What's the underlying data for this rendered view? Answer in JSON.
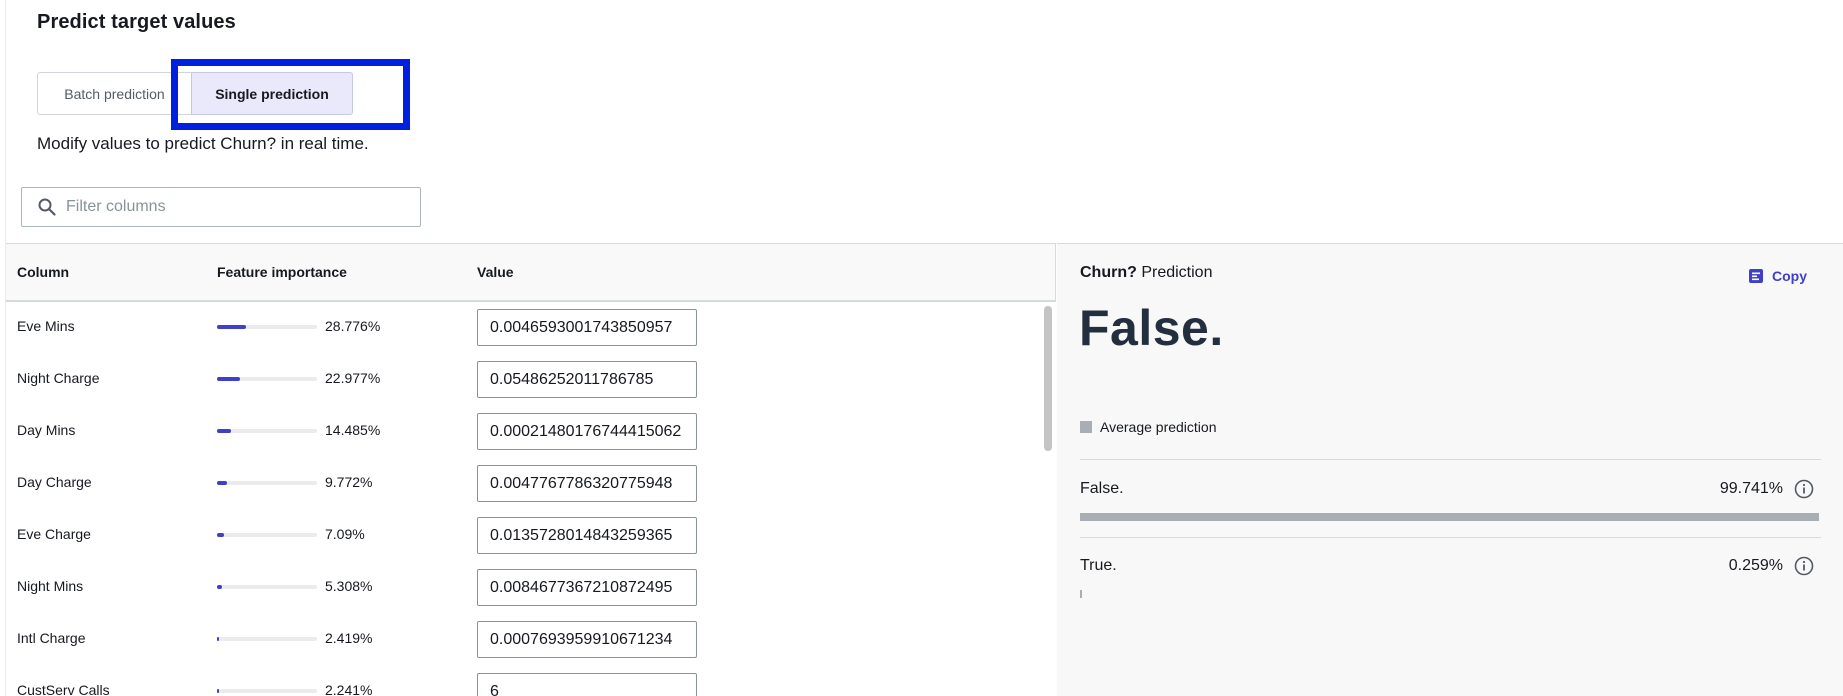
{
  "page": {
    "title": "Predict target values",
    "subtitle": "Modify values to predict Churn? in real time."
  },
  "mode": {
    "options": [
      "Batch prediction",
      "Single prediction"
    ],
    "selected": "Single prediction"
  },
  "filter": {
    "placeholder": "Filter columns"
  },
  "table": {
    "headers": {
      "column": "Column",
      "importance": "Feature importance",
      "value": "Value"
    },
    "rows": [
      {
        "name": "Eve Mins",
        "importance_pct": "28.776%",
        "importance": 0.28776,
        "value": "0.0046593001743850957"
      },
      {
        "name": "Night Charge",
        "importance_pct": "22.977%",
        "importance": 0.22977,
        "value": "0.05486252011786785"
      },
      {
        "name": "Day Mins",
        "importance_pct": "14.485%",
        "importance": 0.14485,
        "value": "0.00021480176744415062"
      },
      {
        "name": "Day Charge",
        "importance_pct": "9.772%",
        "importance": 0.09772,
        "value": "0.0047767786320775948"
      },
      {
        "name": "Eve Charge",
        "importance_pct": "7.09%",
        "importance": 0.0709,
        "value": "0.0135728014843259365"
      },
      {
        "name": "Night Mins",
        "importance_pct": "5.308%",
        "importance": 0.05308,
        "value": "0.0084677367210872495"
      },
      {
        "name": "Intl Charge",
        "importance_pct": "2.419%",
        "importance": 0.02419,
        "value": "0.0007693959910671234"
      },
      {
        "name": "CustServ Calls",
        "importance_pct": "2.241%",
        "importance": 0.02241,
        "value": "6"
      }
    ]
  },
  "prediction": {
    "target": "Churn?",
    "heading_suffix": "Prediction",
    "copy_label": "Copy",
    "value": "False.",
    "legend_label": "Average prediction",
    "results": [
      {
        "label": "False.",
        "pct": "99.741%",
        "fraction": 0.99741
      },
      {
        "label": "True.",
        "pct": "0.259%",
        "fraction": 0.00259
      }
    ]
  },
  "colors": {
    "accent": "#3f3fc8",
    "focus_ring": "#0020e0",
    "selected_segment_bg": "#e9e9fb",
    "bar_gray": "#a9aeb5"
  }
}
